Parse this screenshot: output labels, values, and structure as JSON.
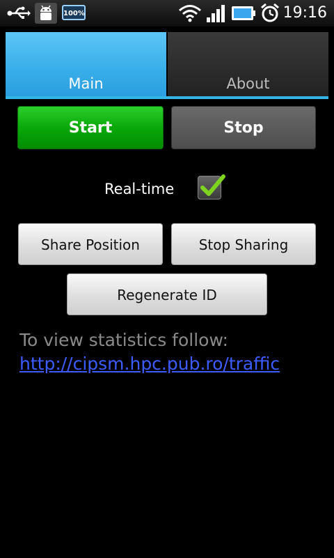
{
  "status_bar": {
    "time": "19:16",
    "battery_badge": "100%",
    "icons": [
      "usb-icon",
      "android-debug-icon",
      "battery-badge-icon",
      "wifi-icon",
      "signal-icon",
      "battery-icon",
      "alarm-icon"
    ]
  },
  "tabs": [
    {
      "label": "Main",
      "selected": true
    },
    {
      "label": "About",
      "selected": false
    }
  ],
  "controls": {
    "start_label": "Start",
    "stop_label": "Stop",
    "realtime_label": "Real-time",
    "realtime_checked": true,
    "share_position_label": "Share Position",
    "stop_sharing_label": "Stop Sharing",
    "regenerate_id_label": "Regenerate ID"
  },
  "stats": {
    "text": "To view statistics follow:",
    "link": "http://cipsm.hpc.pub.ro/traffic"
  },
  "colors": {
    "accent": "#33b5e5",
    "start_green": "#0aa80a",
    "link_blue": "#3c5cff"
  }
}
